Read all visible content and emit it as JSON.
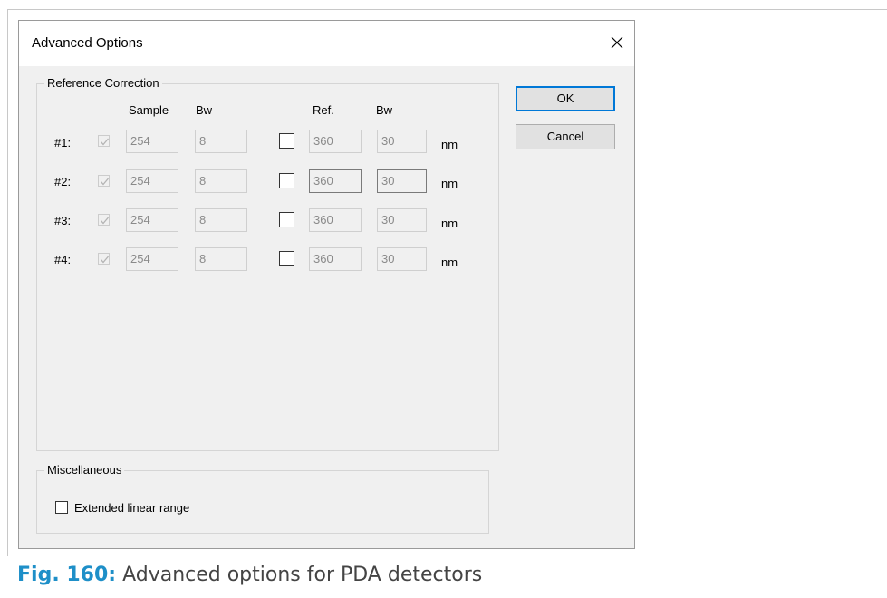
{
  "dialog": {
    "title": "Advanced Options",
    "ok_label": "OK",
    "cancel_label": "Cancel"
  },
  "reference_correction": {
    "group_label": "Reference Correction",
    "headers": {
      "sample": "Sample",
      "bw": "Bw",
      "ref": "Ref.",
      "ref_bw": "Bw"
    },
    "rows": [
      {
        "label": "#1:",
        "sample": "254",
        "bw": "8",
        "ref": "360",
        "ref_bw": "30",
        "unit": "nm"
      },
      {
        "label": "#2:",
        "sample": "254",
        "bw": "8",
        "ref": "360",
        "ref_bw": "30",
        "unit": "nm"
      },
      {
        "label": "#3:",
        "sample": "254",
        "bw": "8",
        "ref": "360",
        "ref_bw": "30",
        "unit": "nm"
      },
      {
        "label": "#4:",
        "sample": "254",
        "bw": "8",
        "ref": "360",
        "ref_bw": "30",
        "unit": "nm"
      }
    ]
  },
  "miscellaneous": {
    "group_label": "Miscellaneous",
    "extended_linear_range_label": "Extended linear range"
  },
  "caption": {
    "figure_label": "Fig. 160:",
    "text": "Advanced options for PDA detectors"
  },
  "colors": {
    "caption_accent": "#1e8fc8",
    "default_button_border": "#0078d7"
  }
}
